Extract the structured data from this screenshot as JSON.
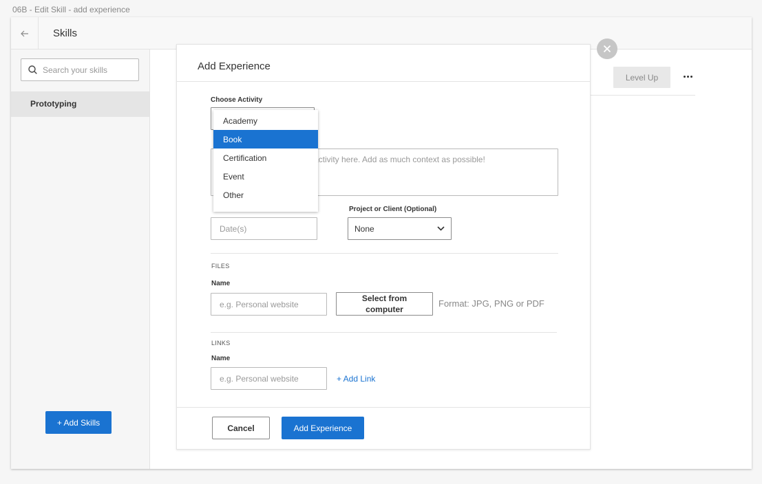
{
  "artboard": {
    "label": "06B - Edit Skill - add experience"
  },
  "topbar": {
    "title": "Skills"
  },
  "sidebar": {
    "search_placeholder": "Search your skills",
    "skills": [
      "Prototyping"
    ],
    "add_skills_label": "+ Add Skills"
  },
  "main": {
    "level_up_label": "Level Up"
  },
  "modal": {
    "title": "Add Experience",
    "choose_activity_label": "Choose Activity",
    "activity_options": [
      {
        "label": "Academy",
        "selected": false
      },
      {
        "label": "Book",
        "selected": true
      },
      {
        "label": "Certification",
        "selected": false
      },
      {
        "label": "Event",
        "selected": false
      },
      {
        "label": "Other",
        "selected": false
      }
    ],
    "description_placeholder_visible": "activity here. Add as much context as possible!",
    "date_placeholder": "Date(s)",
    "project_label": "Project or Client (Optional)",
    "project_value": "None",
    "files": {
      "section_label": "FILES",
      "name_label": "Name",
      "name_placeholder": "e.g. Personal website",
      "select_button": "Select from computer",
      "format_text": "Format: JPG, PNG or PDF"
    },
    "links": {
      "section_label": "LINKS",
      "name_label": "Name",
      "name_placeholder": "e.g. Personal website",
      "add_link_label": "+ Add Link"
    },
    "cancel_label": "Cancel",
    "submit_label": "Add Experience"
  },
  "colors": {
    "primary": "#1a73d1",
    "border": "#e3e3e3"
  },
  "icons": {
    "back": "arrow-left-icon",
    "search": "search-icon",
    "close": "close-icon",
    "more": "more-horizontal-icon",
    "chevron": "chevron-down-icon"
  }
}
